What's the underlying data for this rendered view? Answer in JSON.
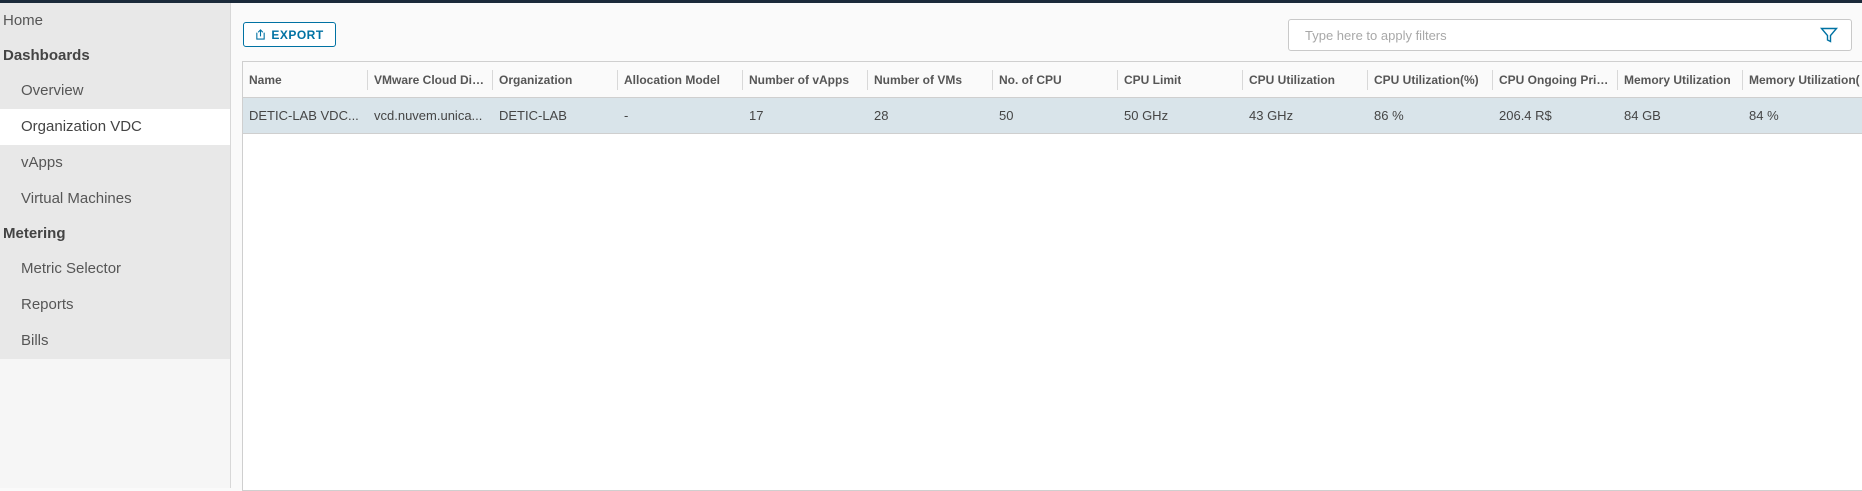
{
  "sidebar": {
    "home": "Home",
    "sections": [
      {
        "header": "Dashboards",
        "items": [
          {
            "label": "Overview",
            "active": false
          },
          {
            "label": "Organization VDC",
            "active": true
          },
          {
            "label": "vApps",
            "active": false
          },
          {
            "label": "Virtual Machines",
            "active": false
          }
        ]
      },
      {
        "header": "Metering",
        "items": [
          {
            "label": "Metric Selector",
            "active": false
          },
          {
            "label": "Reports",
            "active": false
          },
          {
            "label": "Bills",
            "active": false
          }
        ]
      }
    ]
  },
  "toolbar": {
    "export_label": "EXPORT",
    "filter_placeholder": "Type here to apply filters"
  },
  "table": {
    "columns": [
      "Name",
      "VMware Cloud Dire...",
      "Organization",
      "Allocation Model",
      "Number of vApps",
      "Number of VMs",
      "No. of CPU",
      "CPU Limit",
      "CPU Utilization",
      "CPU Utilization(%)",
      "CPU Ongoing Price ...",
      "Memory Utilization",
      "Memory Utilization("
    ],
    "rows": [
      [
        "DETIC-LAB VDC...",
        "vcd.nuvem.unica...",
        "DETIC-LAB",
        "-",
        "17",
        "28",
        "50",
        "50 GHz",
        "43 GHz",
        "86 %",
        "206.4 R$",
        "84 GB",
        "84 %"
      ]
    ]
  },
  "colors": {
    "accent": "#0072a3",
    "selected_row": "#d9e4ea",
    "topbar": "#1b2a3a"
  }
}
